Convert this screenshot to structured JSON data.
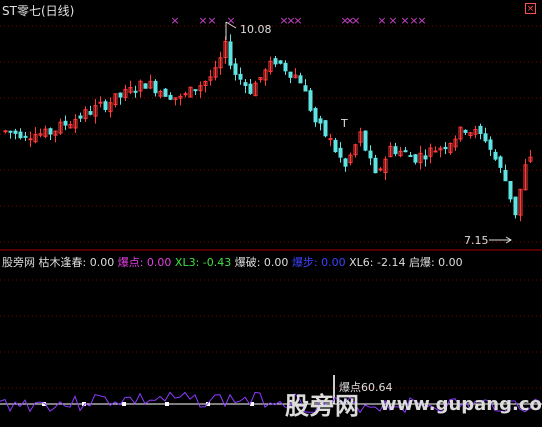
{
  "header": {
    "title": "ST零七(日线)"
  },
  "colors": {
    "up": "#ff3b3b",
    "down": "#5fe3e3",
    "bg": "#000000",
    "grid": "#8b0000",
    "marker": "#d040d0",
    "label": "#dddddd"
  },
  "chart_data": [
    {
      "type": "candlestick",
      "title": "ST零七(日线)",
      "annotations": {
        "high": "10.08",
        "low": "7.15"
      },
      "marker_glyph": "×",
      "t_marker": "T",
      "price_range": [
        6.8,
        10.3
      ]
    },
    {
      "type": "line",
      "indicator_values": [
        {
          "label": "股旁网",
          "value": "",
          "color": "#dddddd"
        },
        {
          "label": "枯木逢春:",
          "value": "0.00",
          "color": "#dddddd"
        },
        {
          "label": "爆点:",
          "value": "0.00",
          "color": "#e040e0"
        },
        {
          "label": "XL3:",
          "value": "-0.43",
          "color": "#40e040"
        },
        {
          "label": "爆破:",
          "value": "0.00",
          "color": "#dddddd"
        },
        {
          "label": "爆步:",
          "value": "0.00",
          "color": "#4040ff"
        },
        {
          "label": "XL6:",
          "value": "-2.14",
          "color": "#dddddd"
        },
        {
          "label": "启爆:",
          "value": "0.00",
          "color": "#dddddd"
        }
      ],
      "burst_annotation": "爆点60.64",
      "watermark": "股旁网 www.gupang.com"
    }
  ]
}
